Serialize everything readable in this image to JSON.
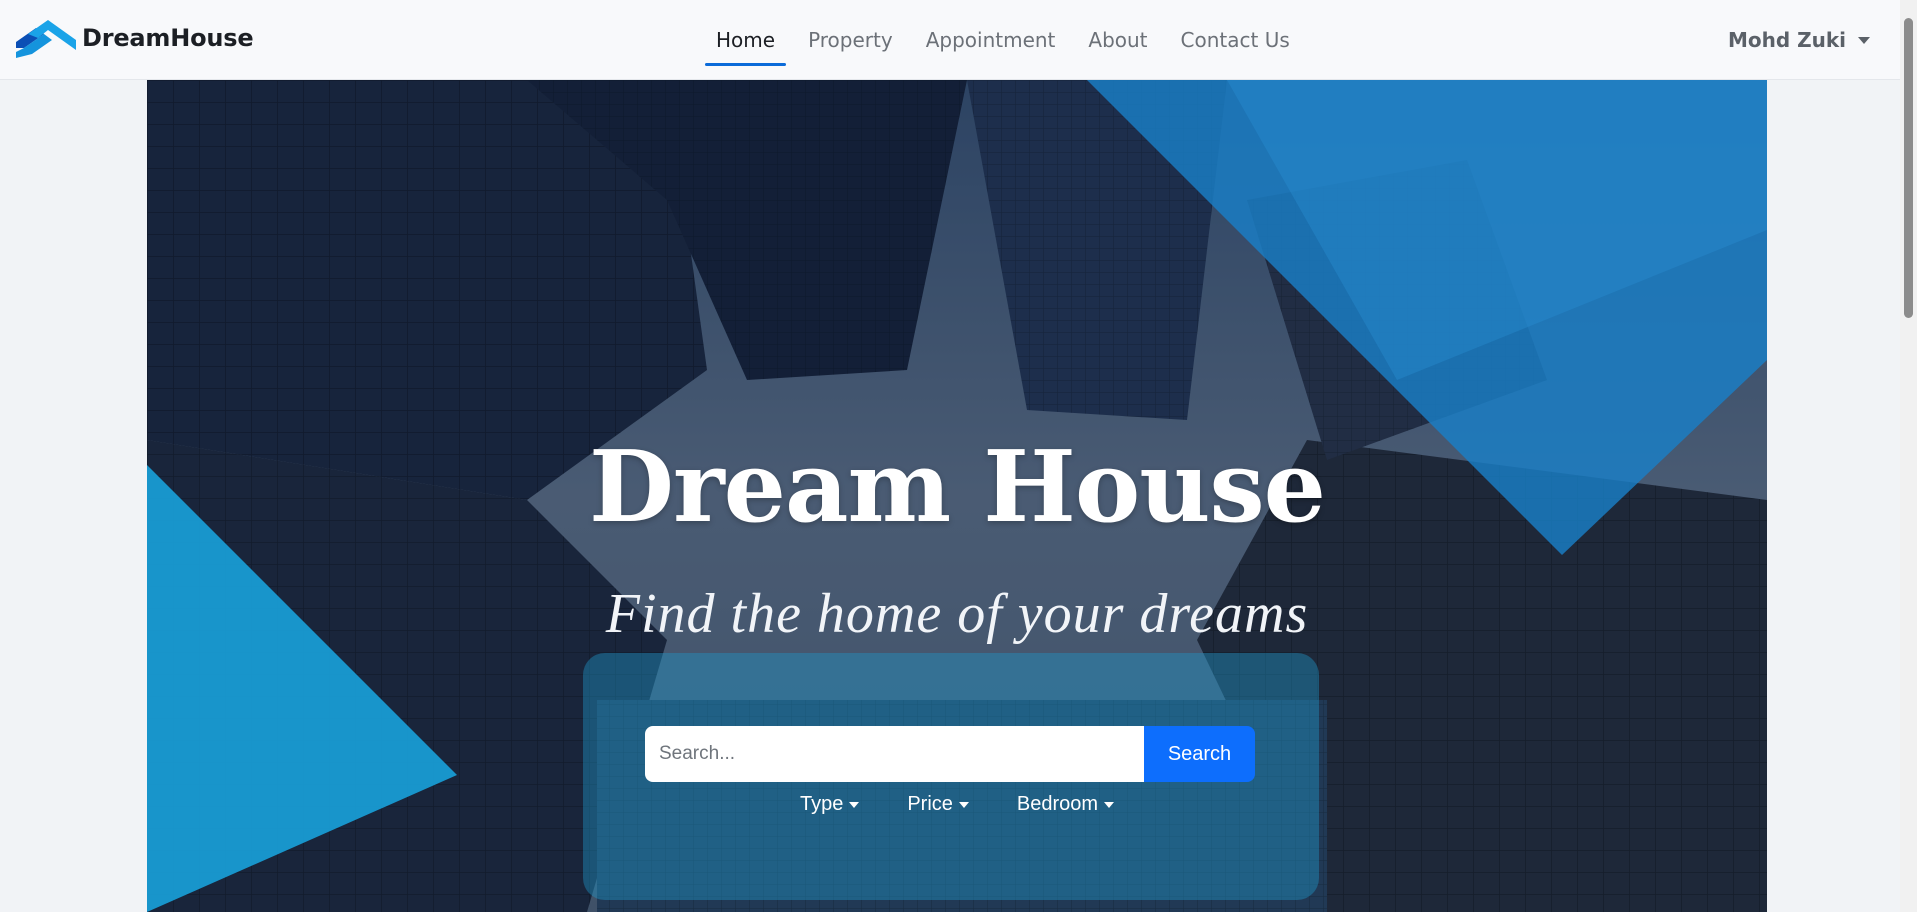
{
  "brand": {
    "name": "DreamHouse",
    "logo_icon": "house-roof-logo-icon",
    "colors": [
      "#0b4fb5",
      "#1aa3e8"
    ]
  },
  "nav": {
    "items": [
      {
        "label": "Home",
        "active": true
      },
      {
        "label": "Property",
        "active": false
      },
      {
        "label": "Appointment",
        "active": false
      },
      {
        "label": "About",
        "active": false
      },
      {
        "label": "Contact Us",
        "active": false
      }
    ],
    "accent": "#0b6bd9"
  },
  "user": {
    "name": "Mohd Zuki",
    "icon": "chevron-down-icon"
  },
  "hero": {
    "title": "Dream House",
    "subtitle": "Find the home of your dreams",
    "search": {
      "placeholder": "Search...",
      "value": "",
      "button_label": "Search",
      "button_color": "#0d6efd"
    },
    "filters": [
      {
        "label": "Type"
      },
      {
        "label": "Price"
      },
      {
        "label": "Bedroom"
      }
    ]
  }
}
